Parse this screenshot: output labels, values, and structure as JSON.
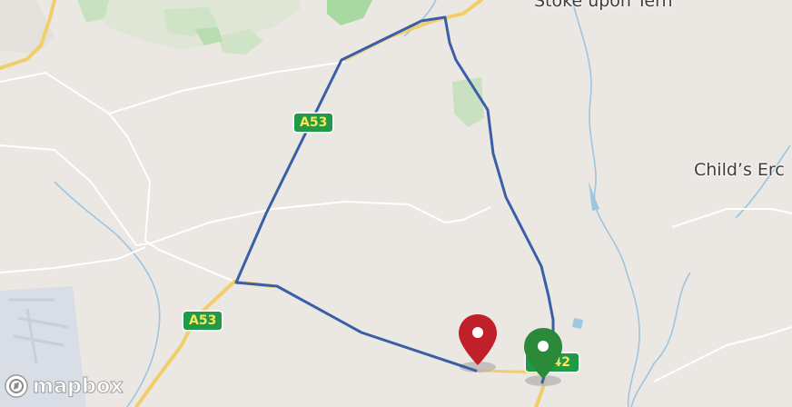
{
  "map": {
    "places": [
      {
        "name": "Stoke upon Tern"
      },
      {
        "name": "Child’s Erc"
      }
    ],
    "roads": [
      {
        "ref": "A53"
      },
      {
        "ref": "A53"
      },
      {
        "ref": "A442"
      }
    ],
    "markers": [
      {
        "type": "origin",
        "color": "#2a8a3a",
        "icon": "map-pin-icon"
      },
      {
        "type": "destination",
        "color": "#c0202a",
        "icon": "map-pin-icon"
      }
    ],
    "route": {
      "color": "#3a5fa8"
    },
    "attribution": {
      "logo_text": "mapbox",
      "icon": "mapbox-logo-icon"
    }
  }
}
